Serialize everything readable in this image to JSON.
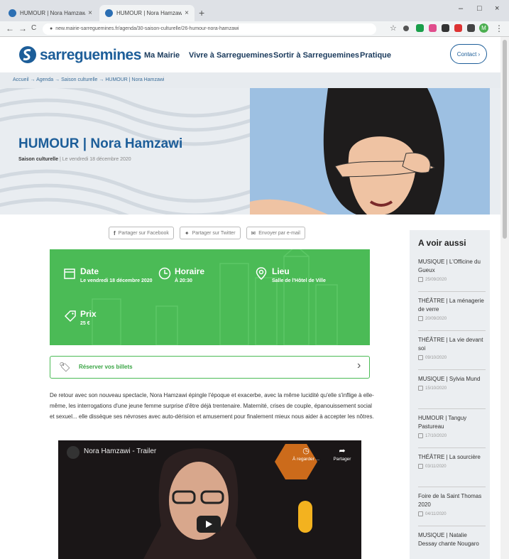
{
  "browser": {
    "tabs": [
      {
        "title": "HUMOUR | Nora Hamzawi - Sar...",
        "close": "×"
      },
      {
        "title": "HUMOUR | Nora Hamzawi - Sar...",
        "close": "×"
      }
    ],
    "new_tab": "+",
    "window": {
      "minimize": "–",
      "maximize": "□",
      "close": "×"
    },
    "nav": {
      "back": "←",
      "forward": "→",
      "reload": "C"
    },
    "url": "new.mairie-sarreguemines.fr/agenda/30-saison-culturelle/26-humour-nora-hamzawi",
    "avatar_letter": "M",
    "menu": "⋮",
    "star": "☆",
    "colors": {
      "tab_active": "#f1f3f4",
      "frame": "#dee1e6"
    }
  },
  "header": {
    "logo_text": "sarreguemines",
    "nav": [
      "Ma Mairie",
      "Vivre à Sarreguemines",
      "Sortir à Sarreguemines",
      "Pratique"
    ],
    "contact": "Contact ›",
    "brand_color": "#1d5e99"
  },
  "breadcrumb": "Accueil  → Agenda  → Saison culturelle  → HUMOUR | Nora Hamzawi",
  "hero": {
    "title": "HUMOUR | Nora Hamzawi",
    "category": "Saison culturelle",
    "date_line": "| Le vendredi 18 décembre 2020"
  },
  "share": {
    "facebook": "Partager sur Facebook",
    "twitter": "Partager sur Twitter",
    "email": "Envoyer par e-mail"
  },
  "info": {
    "date_label": "Date",
    "date_value": "Le vendredi 18 décembre 2020",
    "time_label": "Horaire",
    "time_value": "À 20:30",
    "place_label": "Lieu",
    "place_value": "Salle de l'Hôtel de Ville",
    "price_label": "Prix",
    "price_value": "25 €",
    "accent": "#4bbb56"
  },
  "ticket": {
    "label": "Réserver vos billets",
    "chevron": "›"
  },
  "description": "De retour avec son nouveau spectacle, Nora Hamzawi épingle l'époque et exacerbe, avec la même lucidité qu'elle s'inflige à elle-même, les interrogations d'une jeune femme surprise d'être déjà trentenaire. Maternité, crises de couple, épanouissement social et sexuel... elle dissèque ses névroses avec auto-dérision et amusement pour finalement mieux nous aider à accepter les nôtres.",
  "video": {
    "title": "Nora Hamzawi - Trailer",
    "watch_later": "À regarder ...",
    "share": "Partager"
  },
  "aside": {
    "title": "A voir aussi",
    "items": [
      {
        "title": "MUSIQUE | L'Officine du Gueux",
        "date": "25/09/2020"
      },
      {
        "title": "THÉÂTRE | La ménagerie de verre",
        "date": "20/09/2020"
      },
      {
        "title": "THÉÂTRE | La vie devant soi",
        "date": "09/10/2020"
      },
      {
        "title": "MUSIQUE | Sylvia Mund",
        "date": "15/10/2020"
      },
      {
        "title": "HUMOUR | Tanguy Pastureau",
        "date": "17/10/2020"
      },
      {
        "title": "THÉÂTRE | La sourcière",
        "date": "03/11/2020"
      },
      {
        "title": "Foire de la Saint Thomas 2020",
        "date": "04/11/2020"
      },
      {
        "title": "MUSIQUE | Natalie Dessay chante Nougaro",
        "date": ""
      }
    ]
  }
}
